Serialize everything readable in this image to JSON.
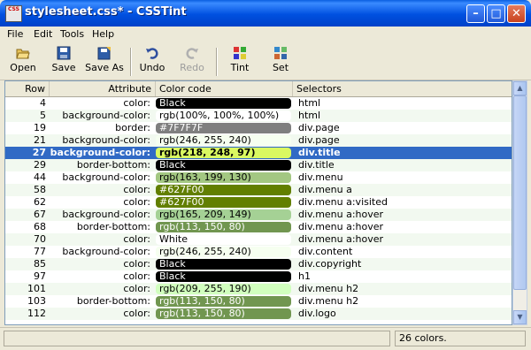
{
  "window": {
    "title": "stylesheet.css* - CSSTint",
    "minimize_label": "–",
    "maximize_label": "□",
    "close_label": "✕",
    "app_icon_text": "CSS"
  },
  "menu": {
    "items": [
      {
        "label": "File"
      },
      {
        "label": "Edit"
      },
      {
        "label": "Tools"
      },
      {
        "label": "Help"
      }
    ]
  },
  "toolbar": {
    "open": "Open",
    "save": "Save",
    "save_as": "Save As",
    "undo": "Undo",
    "redo": "Redo",
    "tint": "Tint",
    "set": "Set"
  },
  "grid": {
    "columns": [
      "Row",
      "Attribute",
      "Color code",
      "Selectors"
    ],
    "rows": [
      {
        "row": "4",
        "attr": "color:",
        "code": "Black",
        "bg": "#000000",
        "fg": "#ffffff",
        "sel": "html"
      },
      {
        "row": "5",
        "attr": "background-color:",
        "code": "rgb(100%, 100%, 100%)",
        "bg": "#ffffff",
        "fg": "#000000",
        "sel": "html"
      },
      {
        "row": "19",
        "attr": "border:",
        "code": "#7F7F7F",
        "bg": "#7F7F7F",
        "fg": "#ffffff",
        "sel": "div.page"
      },
      {
        "row": "21",
        "attr": "background-color:",
        "code": "rgb(246, 255, 240)",
        "bg": "#F6FFF0",
        "fg": "#000000",
        "sel": "div.page"
      },
      {
        "row": "27",
        "attr": "background-color:",
        "code": "rgb(218, 248, 97)",
        "bg": "#DAF861",
        "fg": "#000000",
        "sel": "div.title",
        "selected": true
      },
      {
        "row": "29",
        "attr": "border-bottom:",
        "code": "Black",
        "bg": "#000000",
        "fg": "#ffffff",
        "sel": "div.title"
      },
      {
        "row": "44",
        "attr": "background-color:",
        "code": "rgb(163, 199, 130)",
        "bg": "#A3C782",
        "fg": "#000000",
        "sel": "div.menu"
      },
      {
        "row": "58",
        "attr": "color:",
        "code": "#627F00",
        "bg": "#627F00",
        "fg": "#ffffff",
        "sel": "div.menu a"
      },
      {
        "row": "62",
        "attr": "color:",
        "code": "#627F00",
        "bg": "#627F00",
        "fg": "#ffffff",
        "sel": "div.menu a:visited"
      },
      {
        "row": "67",
        "attr": "background-color:",
        "code": "rgb(165, 209, 149)",
        "bg": "#A5D195",
        "fg": "#000000",
        "sel": "div.menu a:hover"
      },
      {
        "row": "68",
        "attr": "border-bottom:",
        "code": "rgb(113, 150, 80)",
        "bg": "#719650",
        "fg": "#ffffff",
        "sel": "div.menu a:hover"
      },
      {
        "row": "70",
        "attr": "color:",
        "code": "White",
        "bg": "#ffffff",
        "fg": "#000000",
        "sel": "div.menu a:hover"
      },
      {
        "row": "77",
        "attr": "background-color:",
        "code": "rgb(246, 255, 240)",
        "bg": "#F6FFF0",
        "fg": "#000000",
        "sel": "div.content"
      },
      {
        "row": "85",
        "attr": "color:",
        "code": "Black",
        "bg": "#000000",
        "fg": "#ffffff",
        "sel": "div.copyright"
      },
      {
        "row": "97",
        "attr": "color:",
        "code": "Black",
        "bg": "#000000",
        "fg": "#ffffff",
        "sel": "h1"
      },
      {
        "row": "101",
        "attr": "color:",
        "code": "rgb(209, 255, 190)",
        "bg": "#D1FFBE",
        "fg": "#000000",
        "sel": "div.menu h2"
      },
      {
        "row": "103",
        "attr": "border-bottom:",
        "code": "rgb(113, 150, 80)",
        "bg": "#719650",
        "fg": "#ffffff",
        "sel": "div.menu h2"
      },
      {
        "row": "112",
        "attr": "color:",
        "code": "rgb(113, 150, 80)",
        "bg": "#719650",
        "fg": "#ffffff",
        "sel": "div.logo"
      }
    ]
  },
  "status": {
    "count": "26 colors."
  }
}
